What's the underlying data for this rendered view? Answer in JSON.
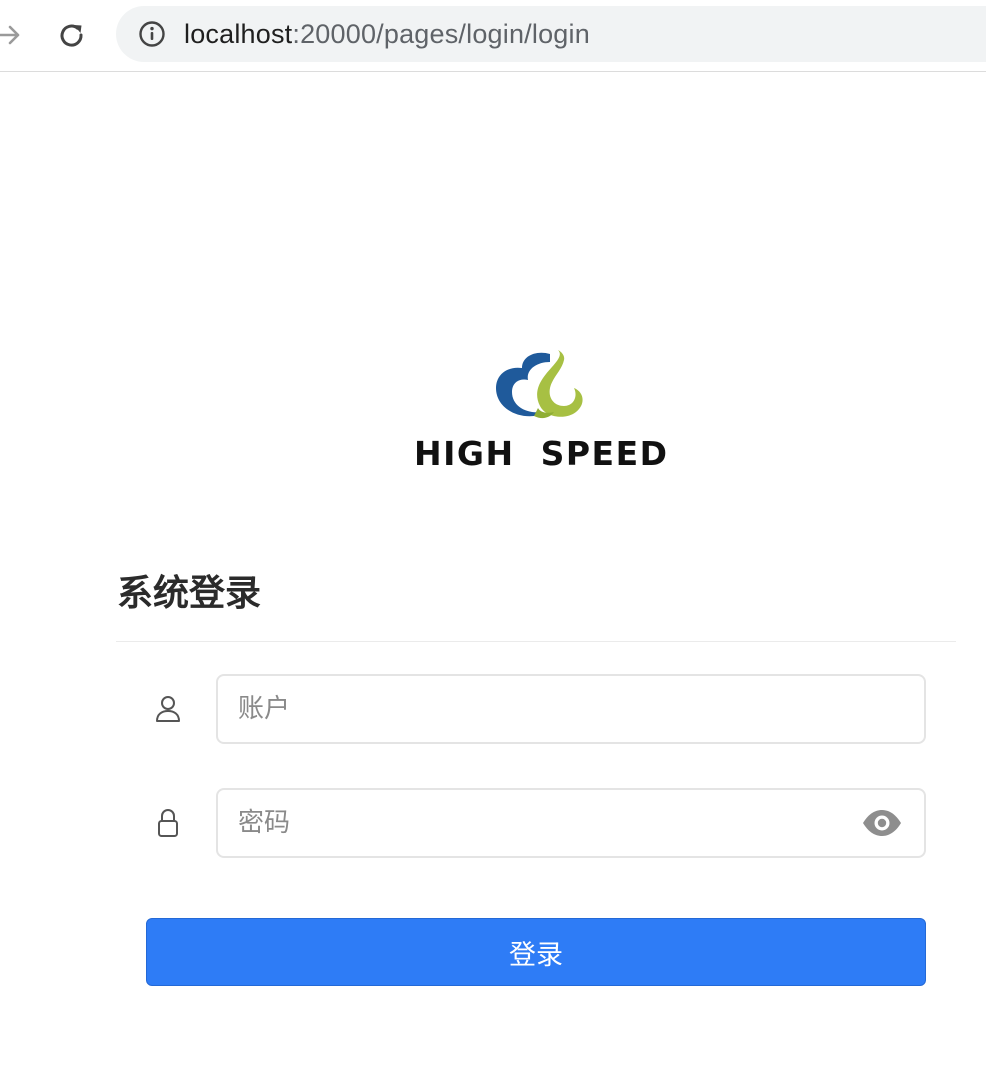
{
  "browser": {
    "url_host": "localhost",
    "url_rest": ":20000/pages/login/login"
  },
  "logo": {
    "text": "HIGH  SPEED",
    "colors": {
      "blue": "#1f5a9b",
      "green": "#a7c043"
    }
  },
  "login": {
    "title": "系统登录",
    "account": {
      "placeholder": "账户",
      "value": "",
      "icon": "user-icon"
    },
    "password": {
      "placeholder": "密码",
      "value": "",
      "icon": "lock-icon",
      "toggle_icon": "eye-icon"
    },
    "submit_label": "登录",
    "accent_color": "#2e7cf6"
  }
}
